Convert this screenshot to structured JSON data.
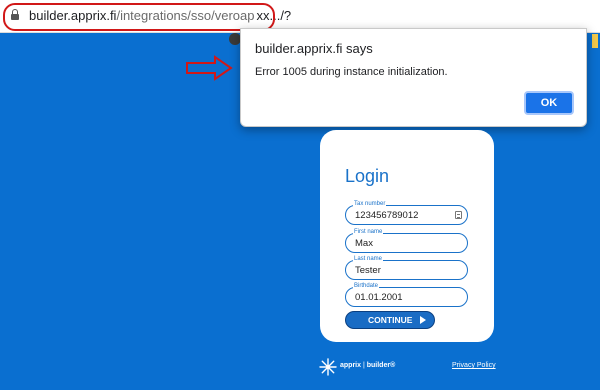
{
  "browser": {
    "url_domain": "builder.apprix.fi",
    "url_path": "/integrations/sso/veroap",
    "url_tail": "xx.../?"
  },
  "dialog": {
    "title": "builder.apprix.fi says",
    "message": "Error 1005 during instance initialization.",
    "ok_label": "OK"
  },
  "login": {
    "title": "Login",
    "fields": [
      {
        "label": "Tax number",
        "value": "123456789012"
      },
      {
        "label": "First name",
        "value": "Max"
      },
      {
        "label": "Last name",
        "value": "Tester"
      },
      {
        "label": "Birthdate",
        "value": "01.01.2001"
      }
    ],
    "continue_label": "CONTINUE"
  },
  "footer": {
    "brand": "apprix",
    "sub_brand": "builder®",
    "privacy_label": "Privacy Policy"
  },
  "colors": {
    "background": "#0a6fd0",
    "accent": "#1a72c9",
    "annotation_red": "#d11818"
  }
}
